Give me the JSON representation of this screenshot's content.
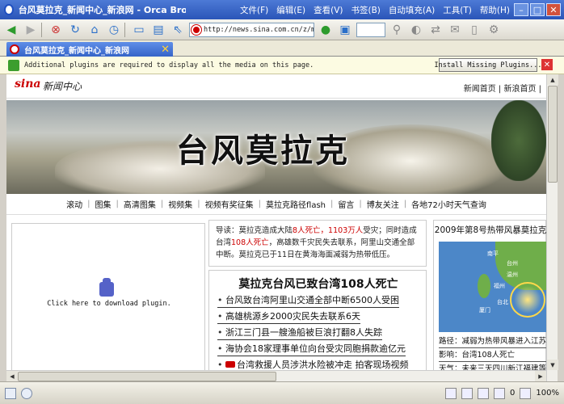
{
  "window": {
    "title": "台风莫拉克_新闻中心_新浪网 - Orca Browser",
    "menu": [
      "文件(F)",
      "编辑(E)",
      "查看(V)",
      "书签(B)",
      "自动填充(A)",
      "工具(T)",
      "帮助(H)"
    ],
    "buttons": {
      "minimize": "–",
      "maximize": "□",
      "close": "✕"
    }
  },
  "toolbar": {
    "url": "http://news.sina.com.cn/z/mora"
  },
  "tab": {
    "label": "台风莫拉克_新闻中心_新浪网",
    "close": "✕"
  },
  "pluginbar": {
    "message": "Additional plugins are required to display all the media on this page.",
    "install_label": "Install Missing Plugins...",
    "close": "✕"
  },
  "page": {
    "logo": "sina",
    "logo_sub": "新闻中心",
    "head_links": "新闻首页  |  新浪首页  |",
    "banner_title": "台风莫拉克",
    "nav": [
      "滚动",
      "图集",
      "高清图集",
      "视频集",
      "视频有奖征集",
      "莫拉克路径flash",
      "留言",
      "博友关注",
      "各地72小时天气查询"
    ],
    "plugin_placeholder": "Click here to download plugin.",
    "lead": {
      "prefix": "导读：莫拉克造成大陆",
      "red1": "8人死亡，1103万人",
      "mid1": "受灾；同时造成台湾",
      "red2": "108人死亡",
      "rest": "，高雄数千灾民失去联系，阿里山交通全部中断。莫拉克已于11日在黄海海面减弱为热带低压。"
    },
    "news_title": "莫拉克台风已致台湾108人死亡",
    "news_items": [
      "台风致台湾阿里山交通全部中断6500人受困",
      "高雄桃源乡2000灾民失去联系6天",
      "浙江三门县一艘渔船被巨浪打翻8人失踪",
      "海协会18家理事单位向台受灾同胞捐款逾亿元",
      "台湾救援人员涉洪水险被冲走 拍客现场视频"
    ],
    "right_title": "2009年第8号热带风暴莫拉克",
    "map_labels": [
      "南平",
      "台州",
      "温州",
      "福州",
      "台北",
      "厦门"
    ],
    "right_items": [
      "路径：减弱为热带风暴进入江苏",
      "影响：台湾108人死亡",
      "天气：未来三天四川新江福建等"
    ]
  },
  "status": {
    "zoom": "100%",
    "count": "0"
  }
}
